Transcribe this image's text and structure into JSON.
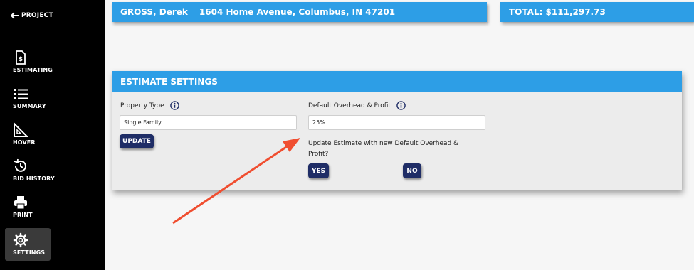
{
  "sidebar": {
    "back_label": "PROJECT",
    "items": [
      {
        "label": "ESTIMATING",
        "icon": "estimate-document-icon"
      },
      {
        "label": "SUMMARY",
        "icon": "list-icon"
      },
      {
        "label": "HOVER",
        "icon": "ruler-triangle-icon"
      },
      {
        "label": "BID HISTORY",
        "icon": "history-icon"
      },
      {
        "label": "PRINT",
        "icon": "printer-icon"
      },
      {
        "label": "SETTINGS",
        "icon": "gear-icon",
        "active": true
      }
    ]
  },
  "header": {
    "customer_name": "GROSS, Derek",
    "address": "1604 Home Avenue, Columbus, IN 47201",
    "total": "TOTAL: $111,297.73"
  },
  "settings": {
    "title": "ESTIMATE SETTINGS",
    "property_type": {
      "label": "Property Type",
      "value": "Single Family"
    },
    "update_button": "UPDATE",
    "overhead": {
      "label": "Default Overhead & Profit",
      "value": "25%"
    },
    "question": "Update Estimate with new Default Overhead & Profit?",
    "yes_button": "YES",
    "no_button": "NO"
  },
  "colors": {
    "accent": "#2d9ee6",
    "button": "#1f2d66",
    "annotation_arrow": "#f04e30",
    "sidebar": "#000000"
  }
}
